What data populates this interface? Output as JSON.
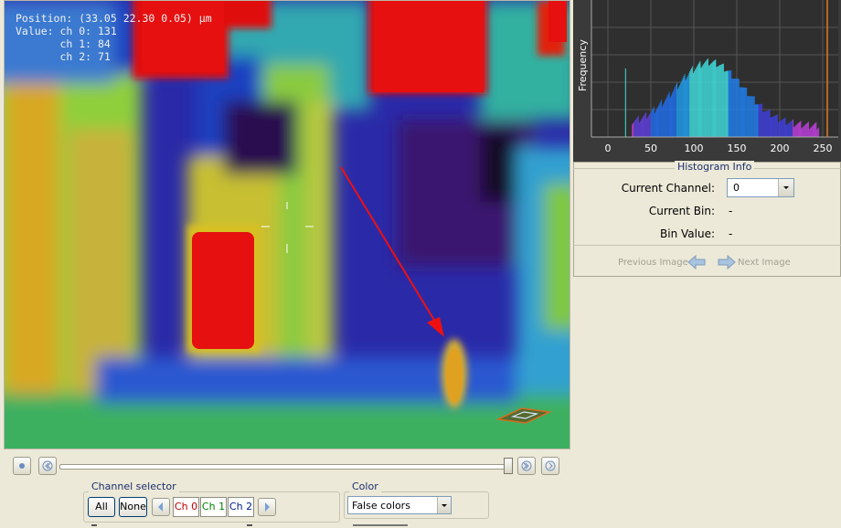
{
  "overlay": {
    "position": "Position: (33.05 22.30 0.05) µm",
    "value": "Value: ch 0: 131",
    "ch1": "       ch 1: 84",
    "ch2": "       ch 2: 71"
  },
  "channel_selector": {
    "title": "Channel selector",
    "all": "All",
    "none": "None",
    "ch0": "Ch 0",
    "ch1": "Ch 1",
    "ch2": "Ch 2"
  },
  "color": {
    "title": "Color",
    "mode": "False colors"
  },
  "histogram": {
    "ylabel": "Frequency",
    "ticks": [
      "0",
      "50",
      "100",
      "150",
      "200",
      "250"
    ]
  },
  "histogram_info": {
    "title": "Histogram Info",
    "current_channel_label": "Current Channel:",
    "current_channel_value": "0",
    "current_bin_label": "Current Bin:",
    "current_bin_value": "-",
    "bin_value_label": "Bin Value:",
    "bin_value_value": "-"
  },
  "navigation": {
    "previous": "Previous Image",
    "next": "Next Image"
  }
}
